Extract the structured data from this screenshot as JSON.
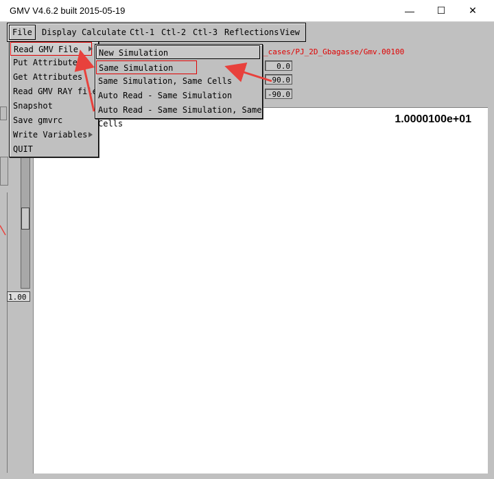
{
  "window": {
    "title": "GMV  V4.6.2 built 2015-05-19",
    "minimize_glyph": "—",
    "maximize_glyph": "☐",
    "close_glyph": "✕"
  },
  "menubar": {
    "items": [
      "File",
      "Display",
      "Calculate",
      "Ctl-1",
      "Ctl-2",
      "Ctl-3",
      "Reflections",
      "View"
    ]
  },
  "file_menu": {
    "items": [
      "Read GMV File",
      "Put Attributes",
      "Get Attributes",
      "Read GMV RAY file",
      "Snapshot",
      "Save gmvrc",
      "Write Variables",
      "QUIT"
    ],
    "highlighted": "Read GMV File"
  },
  "read_submenu": {
    "items": [
      "New Simulation",
      "Same Simulation",
      "Same Simulation, Same Cells",
      "Auto Read - Same Simulation",
      "Auto Read - Same Simulation, Same Cells"
    ],
    "annotated": "Same Simulation"
  },
  "background": {
    "file_path": "_cases/PJ_2D_Gbagasse/Gmv.00100",
    "rot_values": [
      "0.0",
      "90.0",
      "-90.0"
    ],
    "slider_value": "1.00",
    "time_value": "1.0000100e+01"
  },
  "annotation_color": "#e8413c",
  "icons": {
    "submenu_arrow": "chevron-right-icon"
  }
}
